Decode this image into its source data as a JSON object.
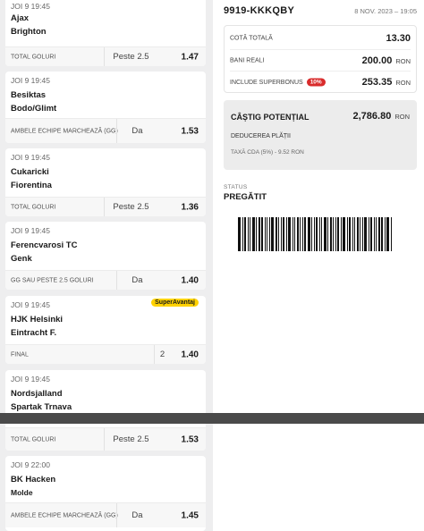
{
  "bets_top": [
    {
      "time": "JOI 9  19:45",
      "home": "Ajax",
      "away": "Brighton",
      "market": "TOTAL GOLURI",
      "selection": "Peste 2.5",
      "odd": "1.47"
    },
    {
      "time": "JOI 9  19:45",
      "home": "Besiktas",
      "away": "Bodo/Glimt",
      "market": "AMBELE ECHIPE MARCHEAZĂ (GG)",
      "selection": "Da",
      "odd": "1.53"
    },
    {
      "time": "JOI 9  19:45",
      "home": "Cukaricki",
      "away": "Fiorentina",
      "market": "TOTAL GOLURI",
      "selection": "Peste 2.5",
      "odd": "1.36"
    },
    {
      "time": "JOI 9  19:45",
      "home": "Ferencvarosi TC",
      "away": "Genk",
      "market": "GG SAU PESTE 2.5 GOLURI",
      "selection": "Da",
      "odd": "1.40"
    },
    {
      "time": "JOI 9  19:45",
      "badge": "SuperAvantaj",
      "home": "HJK Helsinki",
      "away": "Eintracht F.",
      "market": "FINAL",
      "selection": "2",
      "odd": "1.40"
    },
    {
      "time": "JOI 9  19:45",
      "home": "Nordsjalland",
      "away": "Spartak Trnava"
    }
  ],
  "bets_bottom": [
    {
      "market": "TOTAL GOLURI",
      "selection": "Peste 2.5",
      "odd": "1.53"
    },
    {
      "time": "JOI 9  22:00",
      "home": "BK Hacken",
      "away": "Molde",
      "market": "AMBELE ECHIPE MARCHEAZĂ (GG)",
      "selection": "Da",
      "odd": "1.45"
    }
  ],
  "ticket": {
    "id": "9919-KKKQBY",
    "date": "8 NOV. 2023 – 19:05",
    "total_odds_label": "COTĂ TOTALĂ",
    "total_odds": "13.30",
    "real_money_label": "BANI REALI",
    "real_money": "200.00",
    "bonus_label": "INCLUDE SUPERBONUS",
    "bonus_pct": "10%",
    "bonus_value": "253.35",
    "currency": "RON",
    "potential_label": "CÂȘTIG POTENȚIAL",
    "potential_value": "2,786.80",
    "deduction_label": "DEDUCEREA PLĂȚII",
    "tax_label": "TAXĂ CDA (5%) - 9.52 RON",
    "status_label": "STATUS",
    "status_value": "PREGĂTIT"
  },
  "colors": {
    "accent_badge": "#ffd200",
    "bonus_pill": "#d92c2c",
    "background": "#eeeeef"
  }
}
